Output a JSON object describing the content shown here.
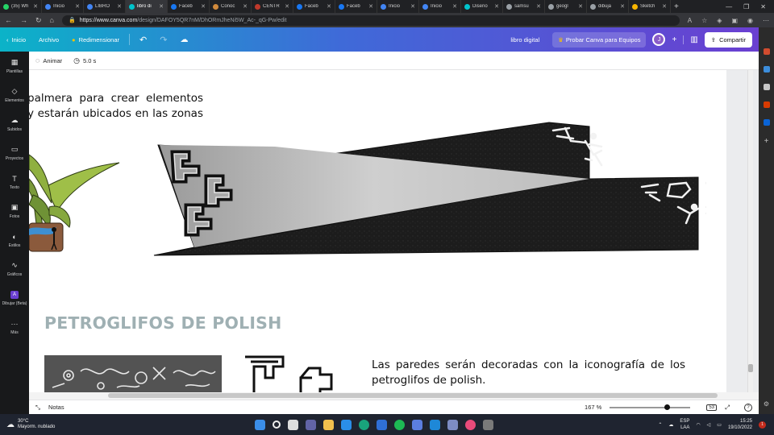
{
  "browser": {
    "tabs": [
      {
        "label": "(35) Wh",
        "color": "#25d366",
        "active": false
      },
      {
        "label": "Inicio",
        "color": "#4285f4",
        "active": false
      },
      {
        "label": "LIBRO",
        "color": "#4285f4",
        "active": false
      },
      {
        "label": "libro di",
        "color": "#00c4cc",
        "active": true
      },
      {
        "label": "Faceb",
        "color": "#1877f2",
        "active": false
      },
      {
        "label": "Conoc",
        "color": "#d08a3c",
        "active": false
      },
      {
        "label": "CENTR",
        "color": "#c0392b",
        "active": false
      },
      {
        "label": "Faceb",
        "color": "#1877f2",
        "active": false
      },
      {
        "label": "Faceb",
        "color": "#1877f2",
        "active": false
      },
      {
        "label": "Inicio",
        "color": "#4285f4",
        "active": false
      },
      {
        "label": "Inicio",
        "color": "#4285f4",
        "active": false
      },
      {
        "label": "Diseño",
        "color": "#00c4cc",
        "active": false
      },
      {
        "label": "samsu",
        "color": "#9aa0a6",
        "active": false
      },
      {
        "label": "geogl",
        "color": "#9aa0a6",
        "active": false
      },
      {
        "label": "dibuja",
        "color": "#9aa0a6",
        "active": false
      },
      {
        "label": "Sketch",
        "color": "#f7b500",
        "active": false
      }
    ],
    "url_host": "https://www.canva.com",
    "url_path": "/design/DAFOY5QR7nM/DhORmJheNi5W_Ac-_qG-Pw/edit"
  },
  "header": {
    "home_label": "Inicio",
    "file_label": "Archivo",
    "resize_label": "Redimensionar",
    "doc_title": "libro digital",
    "try_label": "Probar Canva para Equipos",
    "avatar_initial": "J",
    "share_label": "Compartir"
  },
  "rail": [
    {
      "label": "Plantillas",
      "icon": "▦"
    },
    {
      "label": "Elementos",
      "icon": "◇"
    },
    {
      "label": "Subidos",
      "icon": "☁"
    },
    {
      "label": "Proyectos",
      "icon": "▭"
    },
    {
      "label": "Texto",
      "icon": "T"
    },
    {
      "label": "Fotos",
      "icon": "▣"
    },
    {
      "label": "Estilos",
      "icon": "◐"
    },
    {
      "label": "Gráficos",
      "icon": "∿"
    },
    {
      "label": "Dibujar (Beta)",
      "icon": "A"
    },
    {
      "label": "Más",
      "icon": "···"
    }
  ],
  "toolbar": {
    "animate_label": "Animar",
    "duration_label": "5.0 s"
  },
  "page": {
    "text_top_line1": "palmera para crear elementos",
    "text_top_line2": "y estarán ubicados en las zonas",
    "heading": "PETROGLIFOS DE POLISH",
    "text_bottom_line1": "Las paredes  serán decoradas con la iconografía de los",
    "text_bottom_line2": "petroglifos de polish."
  },
  "bottombar": {
    "notes_label": "Notas",
    "zoom_label": "167 %",
    "page_count": "53"
  },
  "taskbar": {
    "temp": "30°C",
    "weather": "Mayorm. nublado",
    "lang1": "ESP",
    "lang2": "LAA",
    "time": "15:25",
    "date": "19/10/2022"
  }
}
